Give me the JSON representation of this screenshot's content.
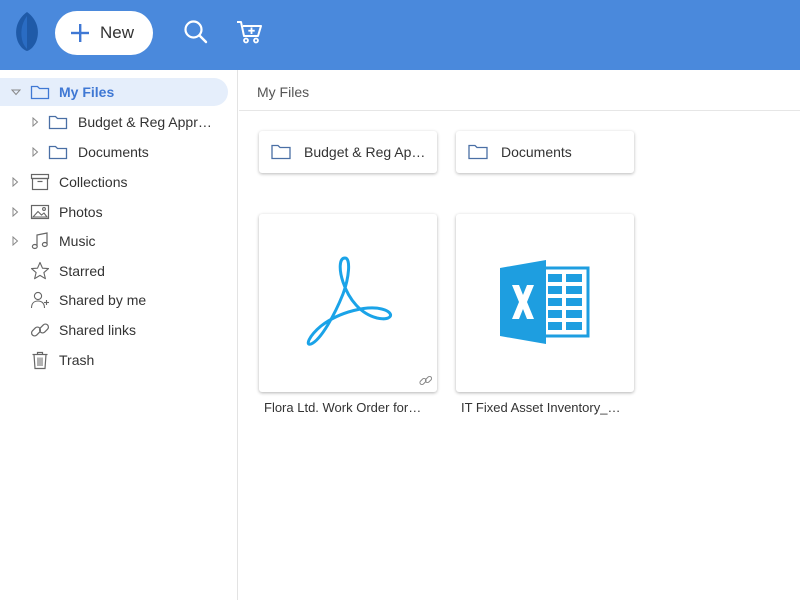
{
  "header": {
    "new_label": "New",
    "accent_color": "#4a89dc"
  },
  "sidebar": {
    "items": [
      {
        "label": "My Files",
        "icon": "folder-icon",
        "expanded": true,
        "selected": true
      },
      {
        "label": "Budget & Reg Appr…",
        "icon": "folder-icon"
      },
      {
        "label": "Documents",
        "icon": "folder-icon"
      },
      {
        "label": "Collections",
        "icon": "archive-box-icon"
      },
      {
        "label": "Photos",
        "icon": "image-icon"
      },
      {
        "label": "Music",
        "icon": "music-note-icon"
      },
      {
        "label": "Starred",
        "icon": "star-icon"
      },
      {
        "label": "Shared by me",
        "icon": "add-user-icon"
      },
      {
        "label": "Shared links",
        "icon": "link-icon"
      },
      {
        "label": "Trash",
        "icon": "trash-icon"
      }
    ]
  },
  "main": {
    "breadcrumb": "My Files",
    "folders": [
      {
        "name": "Budget & Reg Ap…"
      },
      {
        "name": "Documents"
      }
    ],
    "files": [
      {
        "name": "Flora Ltd. Work Order for…",
        "type": "pdf",
        "icon": "acrobat-pdf-icon",
        "shared_link": true
      },
      {
        "name": "IT Fixed Asset Inventory_…",
        "type": "xlsx",
        "icon": "excel-icon",
        "shared_link": false
      }
    ]
  }
}
